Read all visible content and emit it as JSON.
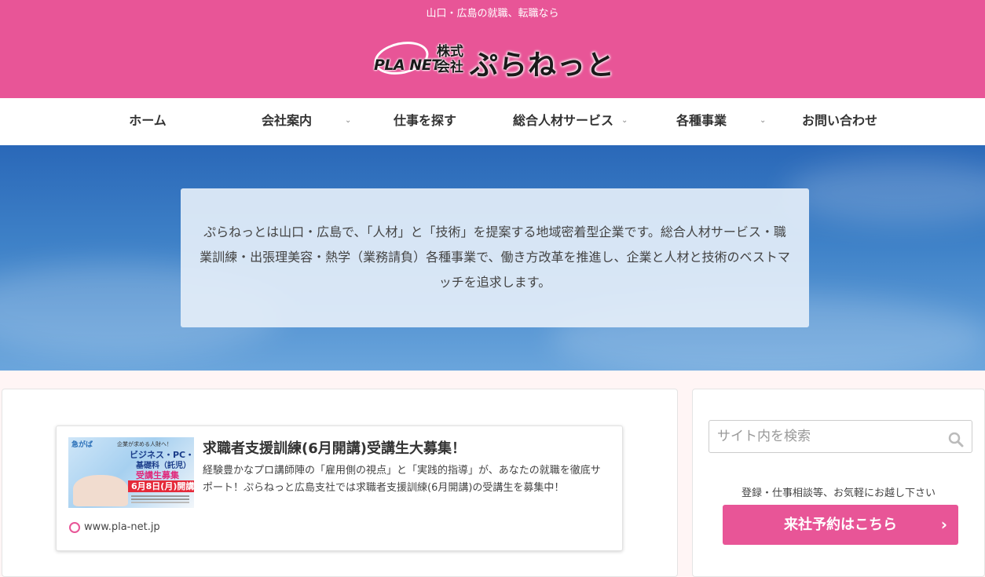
{
  "header": {
    "tagline": "山口・広島の就職、転職なら",
    "logo": {
      "mark_text": "PLA NET",
      "corp_prefix": "株式会社",
      "company_name": "ぷらねっと"
    },
    "bg_color": "#e85597"
  },
  "nav": {
    "items": [
      {
        "label": "ホーム",
        "has_dropdown": false
      },
      {
        "label": "会社案内",
        "has_dropdown": true
      },
      {
        "label": "仕事を探す",
        "has_dropdown": false
      },
      {
        "label": "総合人材サービス",
        "has_dropdown": true
      },
      {
        "label": "各種事業",
        "has_dropdown": true
      },
      {
        "label": "お問い合わせ",
        "has_dropdown": false
      }
    ],
    "dropdown_icon": "chevron-down-icon"
  },
  "hero": {
    "text": "ぷらねっとは山口・広島で、「人材」と「技術」を提案する地域密着型企業です。総合人材サービス・職業訓練・出張理美容・熱学（業務請負）各種事業で、働き方改革を推進し、企業と人材と技術のベストマッチを追求します。"
  },
  "blog_card": {
    "title": "求職者支援訓練(6月開講)受講生大募集！",
    "snippet": "経験豊かなプロ講師陣の「雇用側の視点」と「実践的指導」が、あなたの就職を徹底サポート！ぷらねっと広島支社では求職者支援訓練(6月開講)の受講生を募集中！",
    "site_url": "www.pla-net.jp",
    "thumbnail": {
      "line1": "急がば",
      "line2": "企業が求める人財へ！",
      "line3": "ビジネス・PC・簿記",
      "line4": "基礎科（託児）",
      "line5": "受講生募集",
      "line6": "6月8日(月)開講"
    }
  },
  "sidebar": {
    "search_placeholder": "サイト内を検索",
    "search_icon": "search-icon",
    "note": "登録・仕事相談等、お気軽にお越し下さい",
    "cta_label": "来社予約はこちら",
    "cta_icon": "chevron-right-icon"
  },
  "colors": {
    "accent": "#e85597",
    "page_bg": "#fff5f5",
    "hero_blue": "#3f82c8"
  }
}
